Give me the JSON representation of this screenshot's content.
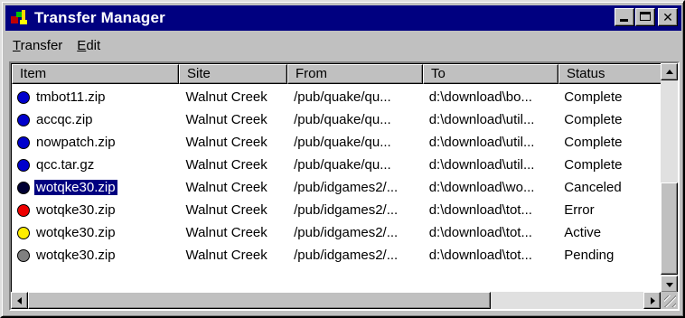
{
  "window": {
    "title": "Transfer Manager"
  },
  "menu": {
    "items": [
      {
        "accel": "T",
        "rest": "ransfer"
      },
      {
        "accel": "E",
        "rest": "dit"
      }
    ]
  },
  "columns": {
    "item": "Item",
    "site": "Site",
    "from": "From",
    "to": "To",
    "status": "Status"
  },
  "rows": [
    {
      "item": "tmbot11.zip",
      "site": "Walnut Creek",
      "from": "/pub/quake/qu...",
      "to": "d:\\download\\bo...",
      "status": "Complete",
      "dot_color": "#0000cc"
    },
    {
      "item": "accqc.zip",
      "site": "Walnut Creek",
      "from": "/pub/quake/qu...",
      "to": "d:\\download\\util...",
      "status": "Complete",
      "dot_color": "#0000cc"
    },
    {
      "item": "nowpatch.zip",
      "site": "Walnut Creek",
      "from": "/pub/quake/qu...",
      "to": "d:\\download\\util...",
      "status": "Complete",
      "dot_color": "#0000cc"
    },
    {
      "item": "qcc.tar.gz",
      "site": "Walnut Creek",
      "from": "/pub/quake/qu...",
      "to": "d:\\download\\util...",
      "status": "Complete",
      "dot_color": "#0000cc"
    },
    {
      "item": "wotqke30.zip",
      "site": "Walnut Creek",
      "from": "/pub/idgames2/...",
      "to": "d:\\download\\wo...",
      "status": "Canceled",
      "dot_color": "#000033",
      "selected": true
    },
    {
      "item": "wotqke30.zip",
      "site": "Walnut Creek",
      "from": "/pub/idgames2/...",
      "to": "d:\\download\\tot...",
      "status": "Error",
      "dot_color": "#ee0000"
    },
    {
      "item": "wotqke30.zip",
      "site": "Walnut Creek",
      "from": "/pub/idgames2/...",
      "to": "d:\\download\\tot...",
      "status": "Active",
      "dot_color": "#ffee00"
    },
    {
      "item": "wotqke30.zip",
      "site": "Walnut Creek",
      "from": "/pub/idgames2/...",
      "to": "d:\\download\\tot...",
      "status": "Pending",
      "dot_color": "#808080"
    }
  ],
  "icons": {
    "app": "transfer-manager-icon",
    "minimize": "minimize-icon",
    "maximize": "maximize-icon",
    "close": "close-icon"
  },
  "colors": {
    "titlebar": "#000080",
    "selection": "#000080",
    "face": "#c0c0c0"
  }
}
